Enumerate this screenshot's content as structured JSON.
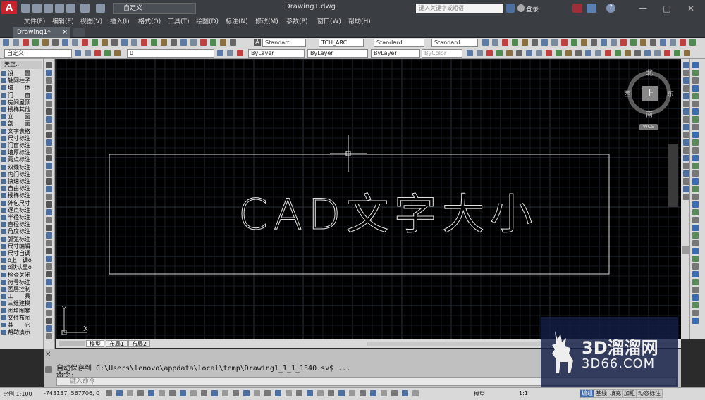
{
  "titlebar": {
    "logo": "A",
    "workspace": "自定义",
    "doc_title": "Drawing1.dwg",
    "search_placeholder": "键入关键字或短语",
    "login": "登录",
    "minimize": "—",
    "maximize": "□",
    "close": "✕"
  },
  "menu": {
    "items": [
      "文件(F)",
      "编辑(E)",
      "视图(V)",
      "插入(I)",
      "格式(O)",
      "工具(T)",
      "绘图(D)",
      "标注(N)",
      "修改(M)",
      "参数(P)",
      "窗口(W)",
      "帮助(H)"
    ]
  },
  "tabs": {
    "doc_tab": "Drawing1*",
    "doc_tab_close": "×"
  },
  "toolbar1": {
    "text_style": "Standard",
    "font_name": "TCH_ARC",
    "dim_style": "Standard",
    "table_style": "Standard"
  },
  "toolbar2": {
    "workspace": "自定义",
    "layer": "0",
    "color": "ByLayer",
    "linetype": "ByLayer",
    "lineweight": "ByLayer",
    "plotstyle": "ByColor"
  },
  "palette": {
    "title": "天正...",
    "items": [
      "设　　置",
      "轴网柱子",
      "墙　　体",
      "门　　窗",
      "房间屋顶",
      "楼梯其他",
      "立　　面",
      "剖　　面",
      "文字表格",
      "尺寸标注",
      "门窗标注",
      "墙厚标注",
      "两点标注",
      "双线标注",
      "内门标注",
      "快速标注",
      "自由标注",
      "楼梯标注",
      "外包尺寸",
      "逐点标注",
      "半径标注",
      "直径标注",
      "角度标注",
      "弧弦标注",
      "尺寸编辑",
      "尺寸自调",
      "o上　调o",
      "o默认显o",
      "检查关闭",
      "符号标注",
      "图层控制",
      "工　　具",
      "三维建模",
      "图块图案",
      "文件布图",
      "其　　它",
      "帮助演示"
    ]
  },
  "canvas": {
    "text": "CAD文字大小",
    "ucs_y": "Y",
    "ucs_x": "X"
  },
  "viewcube": {
    "north": "北",
    "south": "南",
    "east": "东",
    "west": "西",
    "top": "上",
    "wcs": "WCS"
  },
  "layout_tabs": {
    "model": "模型",
    "layout1": "布局1",
    "layout2": "布局2"
  },
  "command": {
    "line1": "自动保存到 C:\\Users\\lenovo\\appdata\\local\\temp\\Drawing1_1_1_1340.sv$ ...",
    "line2": "命令:",
    "input_placeholder": "键入命令"
  },
  "status": {
    "scale": "比例 1:100",
    "coords": "-743137, 567706, 0",
    "model": "模型",
    "annot_scale": "1:1",
    "btn_edit": "编组",
    "btn_baseline": "基线",
    "btn_fill": "填充",
    "btn_bold": "加粗",
    "btn_dynamic": "动态标注"
  },
  "watermark": {
    "line1": "3D溜溜网",
    "line2": "3D66.COM"
  }
}
